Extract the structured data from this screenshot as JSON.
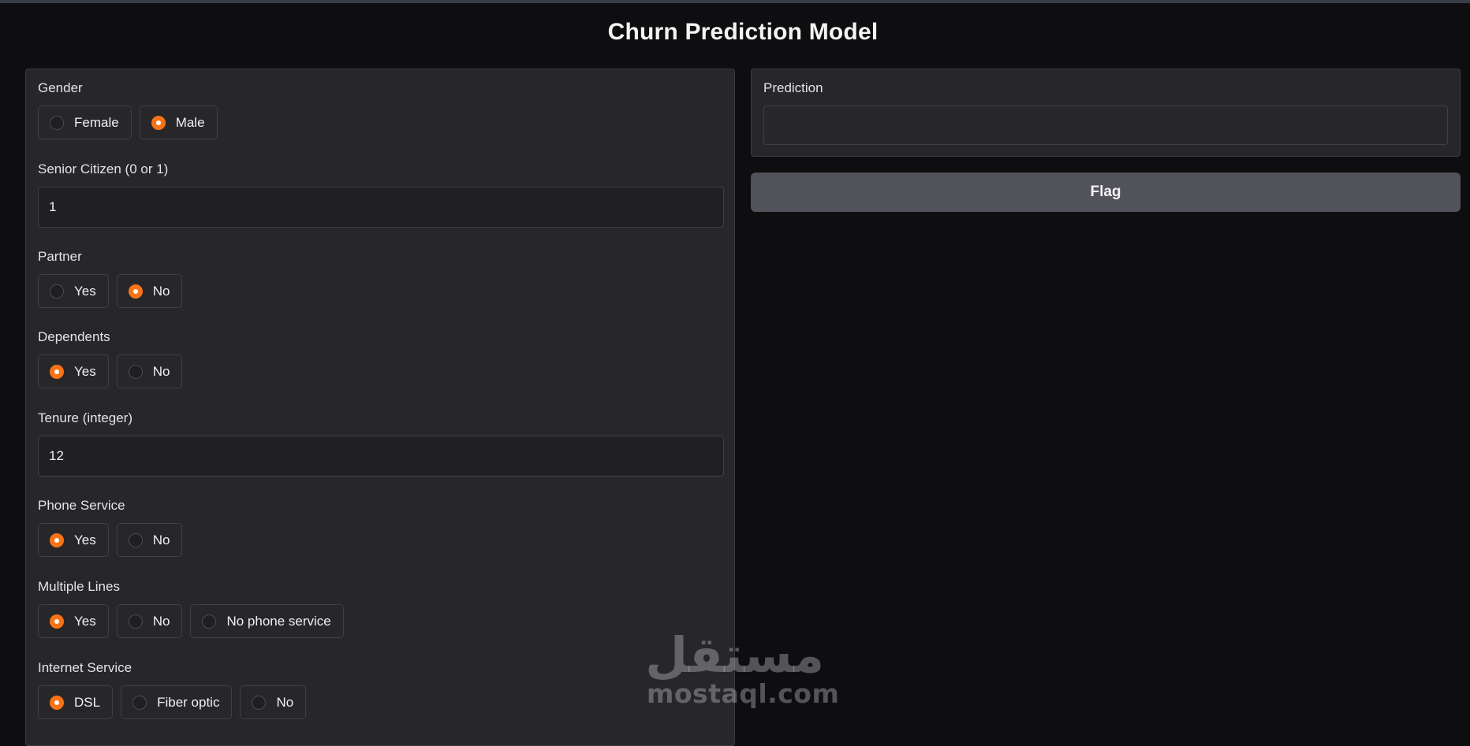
{
  "app": {
    "title": "Churn Prediction Model"
  },
  "form": {
    "gender": {
      "label": "Gender",
      "options": [
        {
          "label": "Female",
          "checked": false
        },
        {
          "label": "Male",
          "checked": true
        }
      ]
    },
    "senior_citizen": {
      "label": "Senior Citizen (0 or 1)",
      "value": "1"
    },
    "partner": {
      "label": "Partner",
      "options": [
        {
          "label": "Yes",
          "checked": false
        },
        {
          "label": "No",
          "checked": true
        }
      ]
    },
    "dependents": {
      "label": "Dependents",
      "options": [
        {
          "label": "Yes",
          "checked": true
        },
        {
          "label": "No",
          "checked": false
        }
      ]
    },
    "tenure": {
      "label": "Tenure (integer)",
      "value": "12"
    },
    "phone_service": {
      "label": "Phone Service",
      "options": [
        {
          "label": "Yes",
          "checked": true
        },
        {
          "label": "No",
          "checked": false
        }
      ]
    },
    "multiple_lines": {
      "label": "Multiple Lines",
      "options": [
        {
          "label": "Yes",
          "checked": true
        },
        {
          "label": "No",
          "checked": false
        },
        {
          "label": "No phone service",
          "checked": false
        }
      ]
    },
    "internet_service": {
      "label": "Internet Service",
      "options": [
        {
          "label": "DSL",
          "checked": true
        },
        {
          "label": "Fiber optic",
          "checked": false
        },
        {
          "label": "No",
          "checked": false
        }
      ]
    }
  },
  "output": {
    "label": "Prediction",
    "value": ""
  },
  "actions": {
    "flag_label": "Flag"
  },
  "watermark": {
    "logo": "مستقل",
    "domain": "mostaql.com"
  },
  "colors": {
    "accent": "#f97316",
    "background": "#0e0e10",
    "panel": "#27272a",
    "button": "#52525b"
  }
}
